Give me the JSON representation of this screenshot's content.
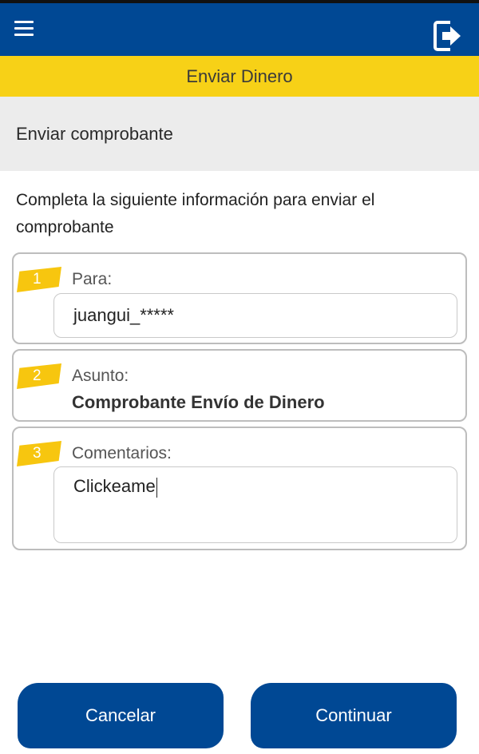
{
  "header": {
    "title": "Enviar Dinero",
    "menu_icon": "hamburger-menu-icon",
    "logout_icon": "logout-icon"
  },
  "subheader": {
    "title": "Enviar comprobante"
  },
  "instructions": "Completa la siguiente información para enviar el comprobante",
  "form": {
    "para": {
      "step": "1",
      "label": "Para:",
      "value": "juangui_*****"
    },
    "asunto": {
      "step": "2",
      "label": "Asunto:",
      "value": "Comprobante Envío de Dinero"
    },
    "comentarios": {
      "step": "3",
      "label": "Comentarios:",
      "value": "Clickeame"
    }
  },
  "buttons": {
    "cancel": "Cancelar",
    "continue": "Continuar"
  },
  "colors": {
    "primary": "#004894",
    "accent": "#f7d117",
    "badge": "#f7c60f",
    "subheader_bg": "#ececec"
  }
}
